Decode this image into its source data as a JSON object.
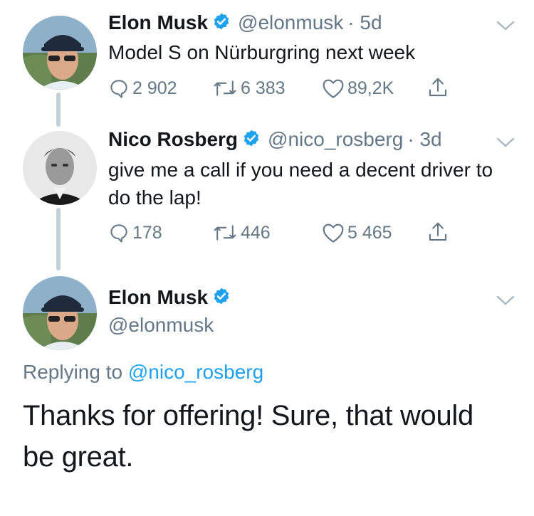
{
  "tweets": [
    {
      "name": "Elon Musk",
      "handle": "@elonmusk",
      "time": "· 5d",
      "text": "Model S on Nürburgring next week",
      "replies": "2 902",
      "retweets": "6 383",
      "likes": "89,2K"
    },
    {
      "name": "Nico Rosberg",
      "handle": "@nico_rosberg",
      "time": "· 3d",
      "text": "give me a call if you need a decent driver to do the lap!",
      "replies": "178",
      "retweets": "446",
      "likes": "5 465"
    }
  ],
  "focused": {
    "name": "Elon Musk",
    "handle": "@elonmusk",
    "replying_prefix": "Replying to",
    "replying_handle": "@nico_rosberg",
    "text": "Thanks for offering! Sure, that would be great."
  },
  "colors": {
    "accent": "#1da1f2",
    "muted": "#657786",
    "verified": "#1da1f2"
  },
  "icons": [
    "verified-badge-icon",
    "chevron-down-icon",
    "reply-icon",
    "retweet-icon",
    "like-icon",
    "share-icon"
  ]
}
